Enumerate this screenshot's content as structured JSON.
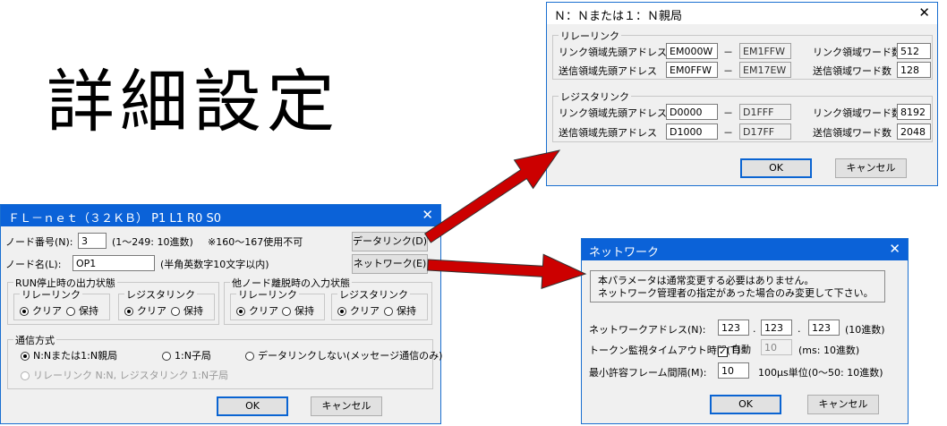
{
  "heading": "詳細設定",
  "main": {
    "title": "ＦＬ－ｎｅｔ（３２ＫＢ） P1 L1 R0 S0",
    "node_no_label": "ノード番号(N):",
    "node_no_value": "3",
    "node_no_range": "(1～249: 10進数)",
    "node_no_note": "※160～167使用不可",
    "node_name_label": "ノード名(L):",
    "node_name_value": "OP1",
    "node_name_hint": "(半角英数字10文字以内)",
    "data_link_button": "データリンク(D)",
    "network_button": "ネットワーク(E)",
    "run_stop_group": "RUN停止時の出力状態",
    "other_node_group": "他ノード離脱時の入力状態",
    "relay_link": "リレーリンク",
    "register_link": "レジスタリンク",
    "clear": "クリア",
    "hold": "保持",
    "comm_group": "通信方式",
    "comm_opt1": "N:Nまたは1:N親局",
    "comm_opt2": "1:N子局",
    "comm_opt3": "データリンクしない(メッセージ通信のみ)",
    "comm_opt4": "リレーリンク N:N, レジスタリンク 1:N子局",
    "ok": "OK",
    "cancel": "キャンセル"
  },
  "nn": {
    "title": "Ｎ：Ｎまたは１：Ｎ親局",
    "relay_group": "リレーリンク",
    "register_group": "レジスタリンク",
    "link_start_label": "リンク領域先頭アドレス",
    "send_start_label": "送信領域先頭アドレス",
    "link_words_label": "リンク領域ワード数",
    "send_words_label": "送信領域ワード数",
    "dash": "－",
    "relay_link_start": "EM000W",
    "relay_link_end": "EM1FFW",
    "relay_link_words": "512",
    "relay_send_start": "EM0FFW",
    "relay_send_end": "EM17EW",
    "relay_send_words": "128",
    "reg_link_start": "D0000",
    "reg_link_end": "D1FFF",
    "reg_link_words": "8192",
    "reg_send_start": "D1000",
    "reg_send_end": "D17FF",
    "reg_send_words": "2048",
    "ok": "OK",
    "cancel": "キャンセル"
  },
  "net": {
    "title": "ネットワーク",
    "info_line1": "本パラメータは通常変更する必要はありません。",
    "info_line2": "ネットワーク管理者の指定があった場合のみ変更して下さい。",
    "addr_label": "ネットワークアドレス(N):",
    "addr1": "123",
    "addr2": "123",
    "addr3": "123",
    "dot": ".",
    "addr_hint": "(10進数)",
    "token_label": "トークン監視タイムアウト時間(T):",
    "auto_label": "自動",
    "token_value": "10",
    "token_hint": "(ms: 10進数)",
    "frame_label": "最小許容フレーム間隔(M):",
    "frame_value": "10",
    "frame_hint": "100μs単位(0～50: 10進数)",
    "ok": "OK",
    "cancel": "キャンセル"
  },
  "colors": {
    "arrow": "#cc0000",
    "title_active": "#0b62d8"
  }
}
